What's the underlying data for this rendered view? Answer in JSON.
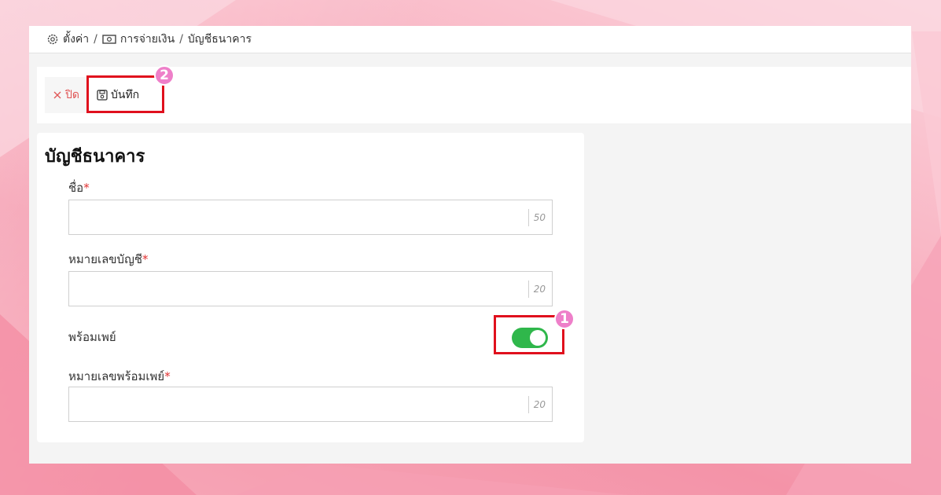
{
  "breadcrumb": {
    "items": [
      "ตั้งค่า",
      "การจ่ายเงิน",
      "บัญชีธนาคาร"
    ],
    "separator": "/"
  },
  "toolbar": {
    "close_label": "ปิด",
    "save_label": "บันทึก"
  },
  "form": {
    "title": "บัญชีธนาคาร",
    "fields": [
      {
        "label": "ชื่อ",
        "required_mark": "*",
        "value": "",
        "max_length": "50"
      },
      {
        "label": "หมายเลขบัญชี",
        "required_mark": "*",
        "value": "",
        "max_length": "20"
      },
      {
        "label": "หมายเลขพร้อมเพย์",
        "required_mark": "*",
        "value": "",
        "max_length": "20"
      }
    ],
    "promptpay_toggle": {
      "label": "พร้อมเพย์",
      "checked": true
    }
  },
  "annotations": [
    "1",
    "2"
  ],
  "colors": {
    "toggle_on": "#2fb74b",
    "highlight": "#e0101d",
    "badge": "#ee7fc9",
    "required": "#e03030"
  }
}
